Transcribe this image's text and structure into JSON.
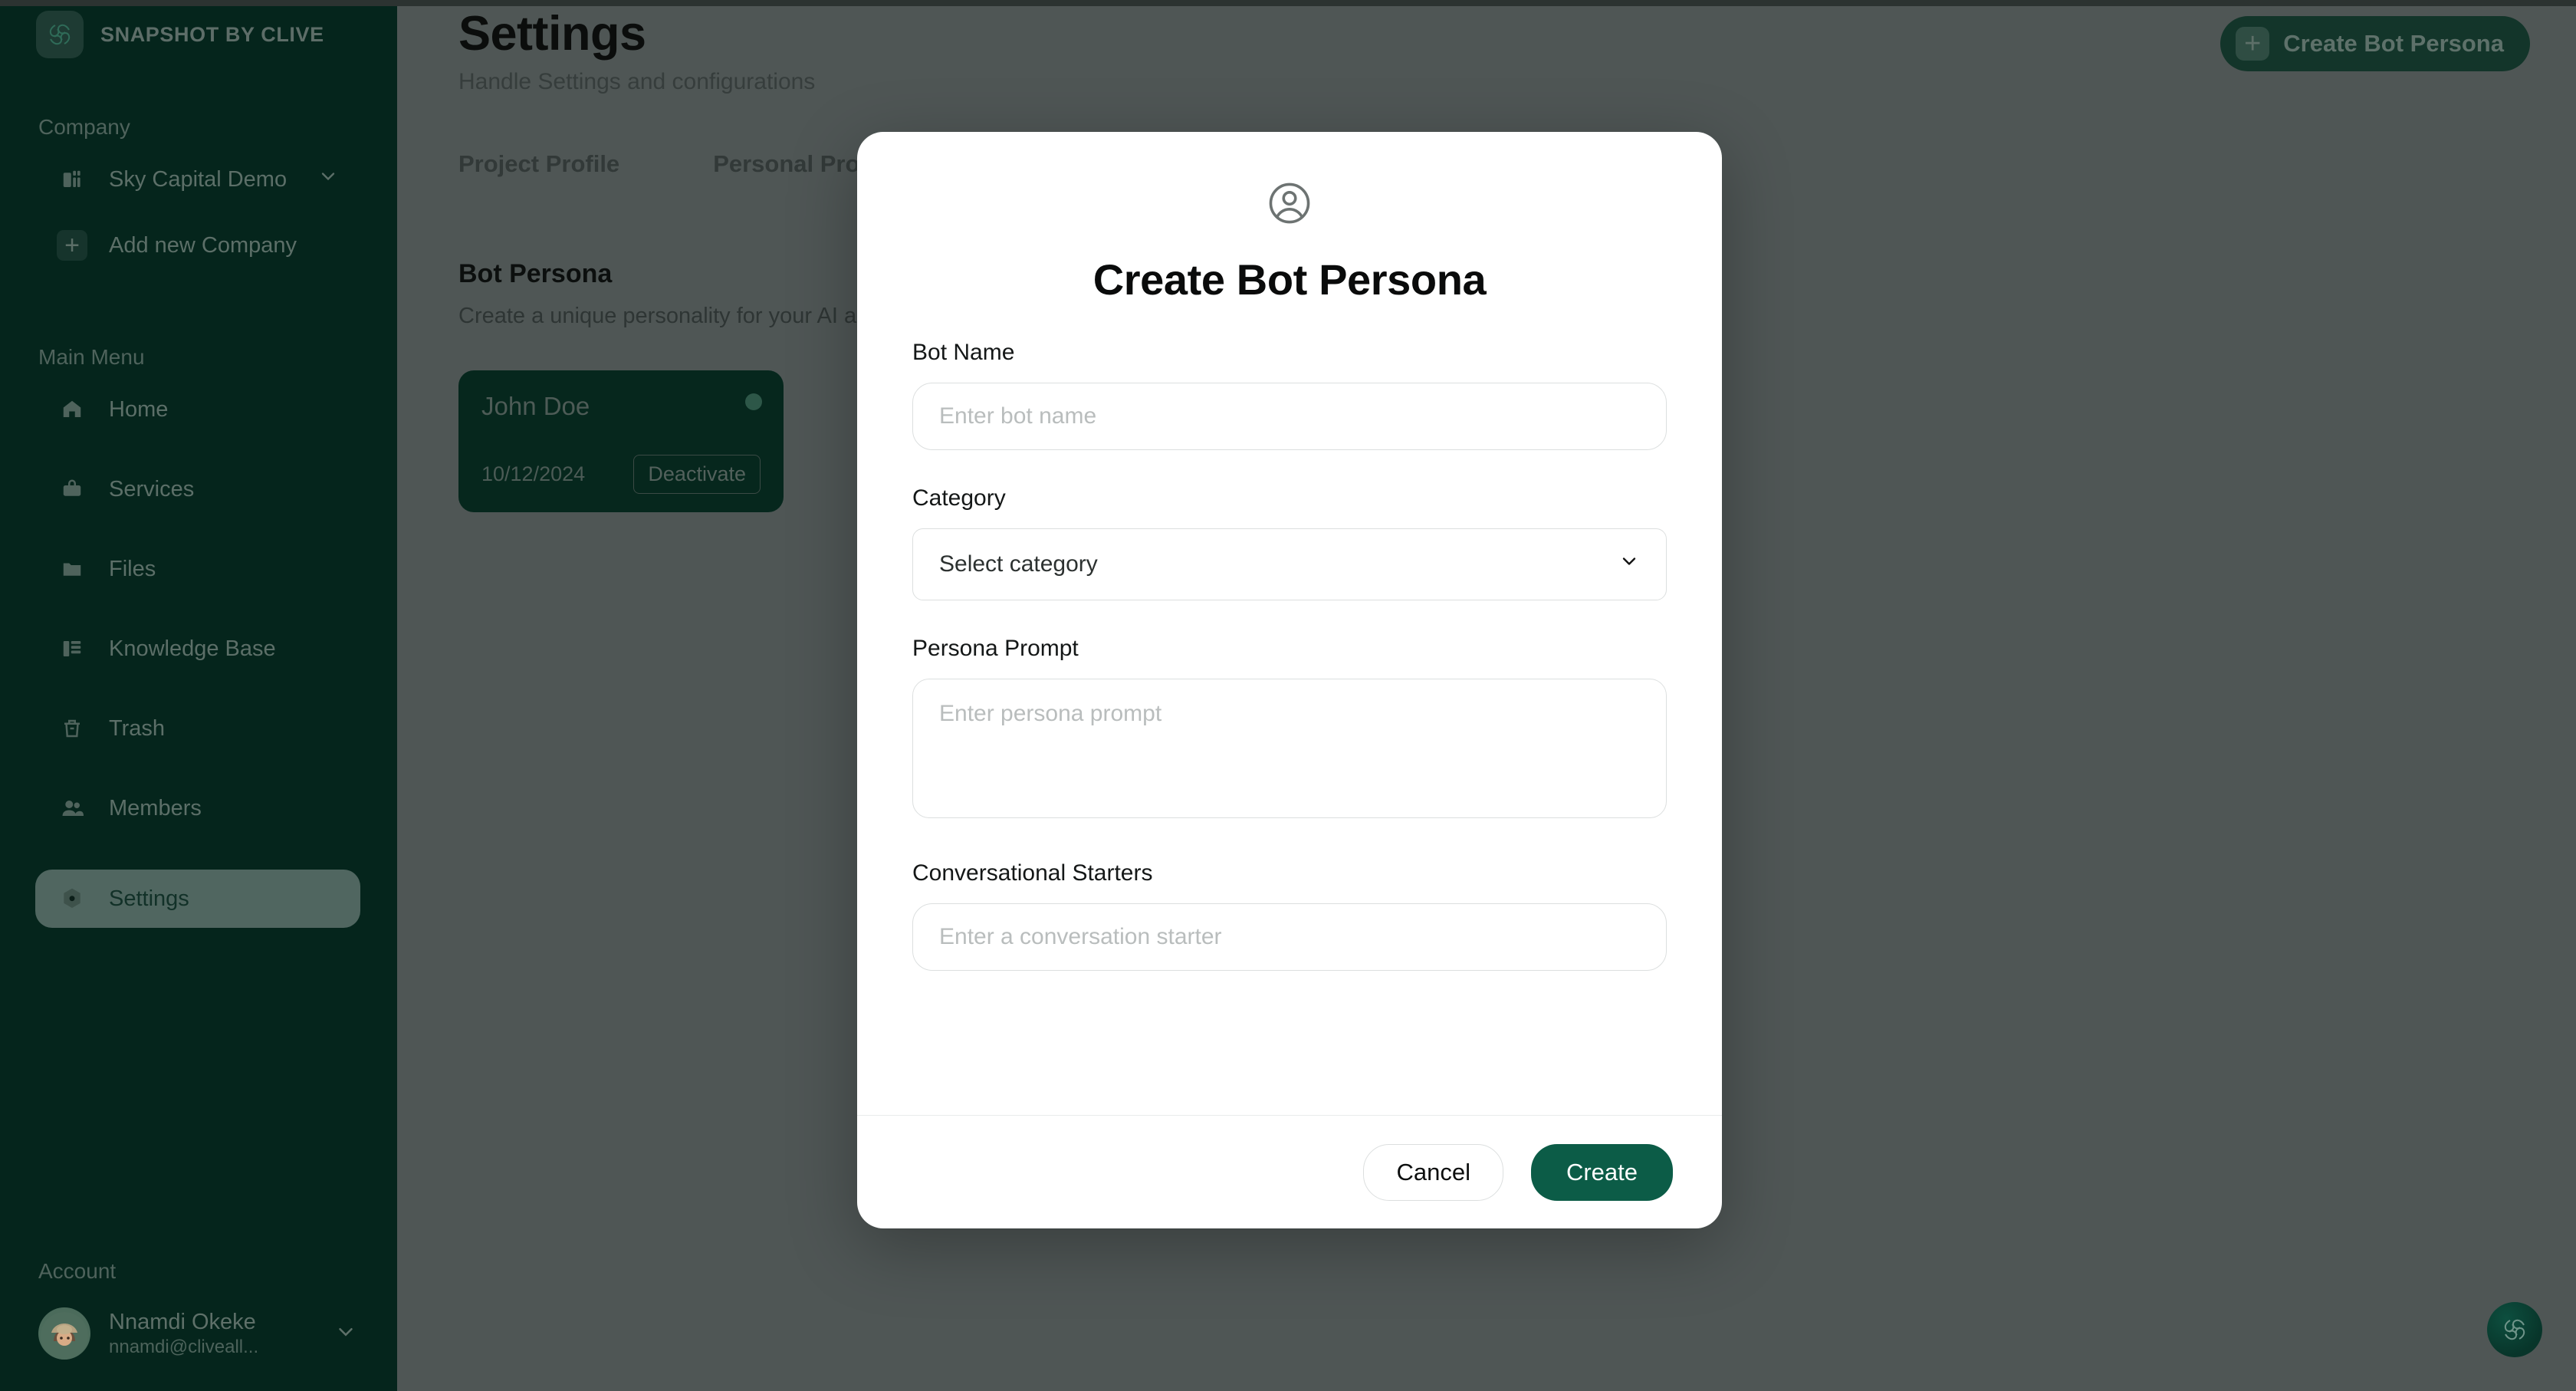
{
  "app": {
    "brand_name": "SNAPSHOT BY CLIVE",
    "logo_icon": "swirl-knot-logo-icon",
    "accent_green": "#0c5c47",
    "sidebar_bg": "#05251c",
    "overlay_bg": "#4f5655"
  },
  "sidebar": {
    "sections": {
      "company": "Company",
      "main_menu": "Main Menu",
      "account": "Account"
    },
    "company": {
      "name": "Sky Capital Demo",
      "icon": "building-icon",
      "chevron_icon": "chevron-down-icon",
      "add_label": "Add new Company",
      "add_icon": "plus-icon"
    },
    "items": [
      {
        "label": "Home",
        "icon": "home-icon",
        "active": false
      },
      {
        "label": "Services",
        "icon": "briefcase-icon",
        "active": false
      },
      {
        "label": "Files",
        "icon": "folder-icon",
        "active": false
      },
      {
        "label": "Knowledge Base",
        "icon": "books-icon",
        "active": false
      },
      {
        "label": "Trash",
        "icon": "trash-icon",
        "active": false
      },
      {
        "label": "Members",
        "icon": "users-icon",
        "active": false
      },
      {
        "label": "Settings",
        "icon": "gear-icon",
        "active": true
      }
    ],
    "account": {
      "name": "Nnamdi Okeke",
      "email": "nnamdi@cliveall...",
      "avatar_icon": "user-avatar",
      "chevron_icon": "chevron-down-icon"
    }
  },
  "page": {
    "title": "Settings",
    "subtitle": "Handle Settings and configurations",
    "tabs": [
      {
        "label": "Project Profile",
        "active": false
      },
      {
        "label": "Personal Profile",
        "active": false
      }
    ],
    "section": {
      "title": "Bot Persona",
      "subtitle": "Create a unique personality for your AI assistant"
    },
    "create_button": {
      "label": "Create Bot Persona",
      "icon": "plus-icon"
    },
    "persona_cards": [
      {
        "name": "John Doe",
        "date": "10/12/2024",
        "action_label": "Deactivate",
        "status_icon": "status-dot"
      }
    ],
    "fab_icon": "swirl-knot-logo-icon"
  },
  "modal": {
    "header_icon": "user-circle-icon",
    "title": "Create Bot Persona",
    "fields": {
      "bot_name": {
        "label": "Bot Name",
        "placeholder": "Enter bot name",
        "value": ""
      },
      "category": {
        "label": "Category",
        "selected": "Select category",
        "chevron_icon": "chevron-down-icon"
      },
      "persona_prompt": {
        "label": "Persona Prompt",
        "placeholder": "Enter persona prompt",
        "value": ""
      },
      "conversational_starters": {
        "label": "Conversational Starters",
        "placeholder": "Enter a conversation starter",
        "value": ""
      }
    },
    "footer": {
      "cancel_label": "Cancel",
      "create_label": "Create"
    }
  }
}
